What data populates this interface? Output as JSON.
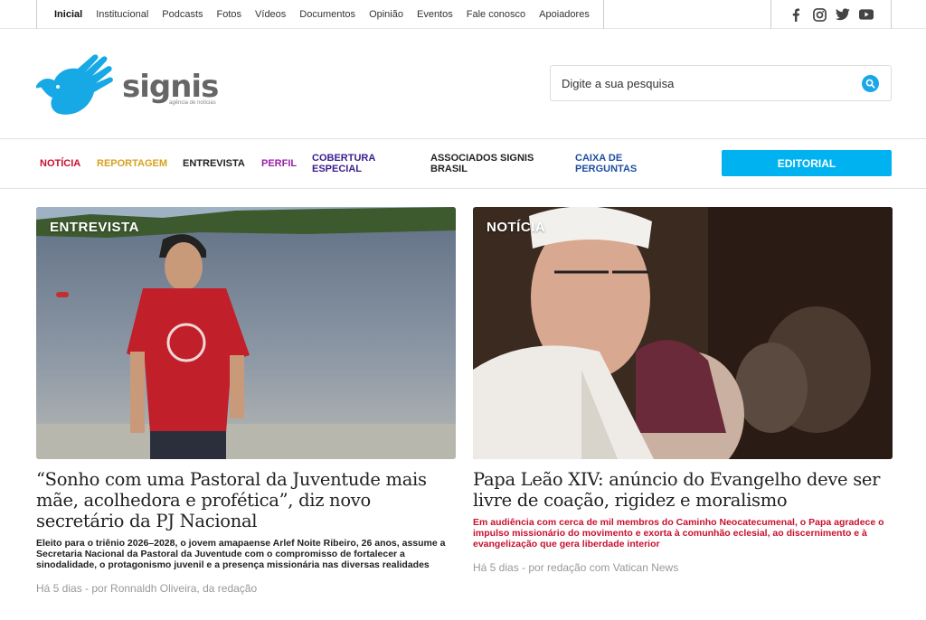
{
  "topnav": {
    "items": [
      "Inicial",
      "Institucional",
      "Podcasts",
      "Fotos",
      "Vídeos",
      "Documentos",
      "Opinião",
      "Eventos",
      "Fale conosco",
      "Apoiadores"
    ]
  },
  "social": [
    "facebook-icon",
    "instagram-icon",
    "twitter-icon",
    "youtube-icon"
  ],
  "logo": {
    "name": "signis",
    "tagline": "agência de notícias"
  },
  "search": {
    "placeholder": "Digite a sua pesquisa"
  },
  "categories": [
    {
      "label": "NOTÍCIA",
      "color": "#c8102e"
    },
    {
      "label": "REPORTAGEM",
      "color": "#d6a21e"
    },
    {
      "label": "ENTREVISTA",
      "color": "#222222"
    },
    {
      "label": "PERFIL",
      "color": "#9b1fa8"
    },
    {
      "label": "COBERTURA ESPECIAL",
      "color": "#3b1d8f"
    },
    {
      "label": "ASSOCIADOS SIGNIS BRASIL",
      "color": "#222222"
    },
    {
      "label": "CAIXA DE PERGUNTAS",
      "color": "#1f4fa0"
    }
  ],
  "editorial": {
    "label": "EDITORIAL",
    "color": "#00b2f0"
  },
  "articles": [
    {
      "tag": "ENTREVISTA",
      "title": "“Sonho com uma Pastoral da Juventude mais mãe, acolhedora e profética”, diz novo secretário da PJ Nacional",
      "lead": "Eleito para o triênio 2026–2028, o jovem amapaense Arlef Noite Ribeiro, 26 anos, assume a Secretaria Nacional da Pastoral da Juventude com o compromisso de fortalecer a sinodalidade, o protagonismo juvenil e a presença missionária nas diversas realidades",
      "lead_color": "#222222",
      "meta": "Há 5 dias - por Ronnaldh Oliveira, da redação"
    },
    {
      "tag": "NOTÍCIA",
      "title": "Papa Leão XIV: anúncio do Evangelho deve ser livre de coação, rigidez e moralismo",
      "lead": "Em audiência com cerca de mil membros do Caminho Neocatecumenal, o Papa agradece o impulso missionário do movimento e exorta à comunhão eclesial, ao discernimento e à evangelização que gera liberdade interior",
      "lead_color": "#c8102e",
      "meta": "Há 5 dias - por redação com Vatican News"
    }
  ]
}
